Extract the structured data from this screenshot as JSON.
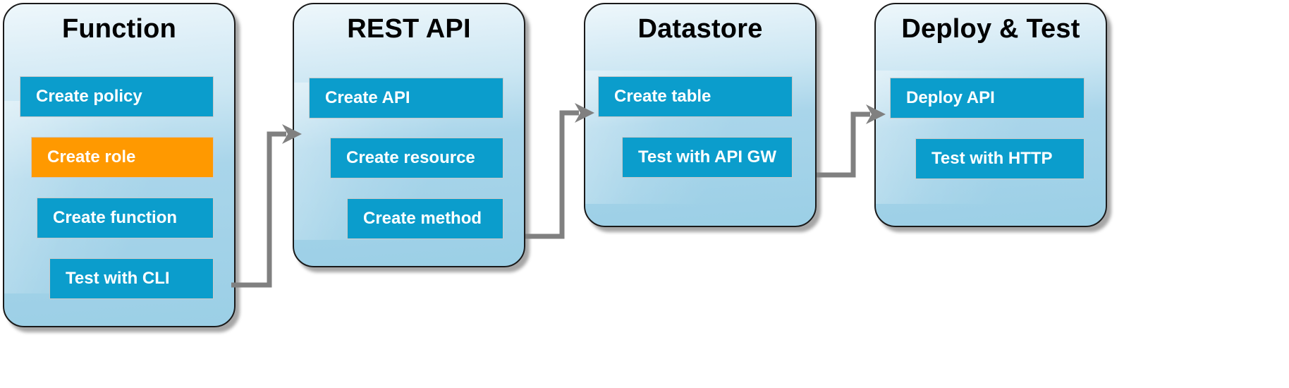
{
  "diagram": {
    "type": "flow",
    "title": "",
    "colors": {
      "step_fill": "#0b9dcc",
      "step_highlight_fill": "#ff9900",
      "step_text": "#ffffff",
      "panel_border": "#1a1a1a",
      "connector": "#808080",
      "panel_gradient_top": "#eef7fb",
      "panel_gradient_bottom": "#9bcfe6"
    },
    "panels": [
      {
        "title": "Function",
        "steps": [
          {
            "label": "Create policy",
            "highlighted": false
          },
          {
            "label": "Create role",
            "highlighted": true
          },
          {
            "label": "Create function",
            "highlighted": false
          },
          {
            "label": "Test with CLI",
            "highlighted": false
          }
        ]
      },
      {
        "title": "REST API",
        "steps": [
          {
            "label": "Create API",
            "highlighted": false
          },
          {
            "label": "Create resource",
            "highlighted": false
          },
          {
            "label": "Create method",
            "highlighted": false
          }
        ]
      },
      {
        "title": "Datastore",
        "steps": [
          {
            "label": "Create table",
            "highlighted": false
          },
          {
            "label": "Test with API GW",
            "highlighted": false
          }
        ]
      },
      {
        "title": "Deploy & Test",
        "steps": [
          {
            "label": "Deploy API",
            "highlighted": false
          },
          {
            "label": "Test with HTTP",
            "highlighted": false
          }
        ]
      }
    ],
    "connectors": [
      {
        "from": "Function",
        "to": "REST API"
      },
      {
        "from": "REST API",
        "to": "Datastore"
      },
      {
        "from": "Datastore",
        "to": "Deploy & Test"
      }
    ]
  }
}
